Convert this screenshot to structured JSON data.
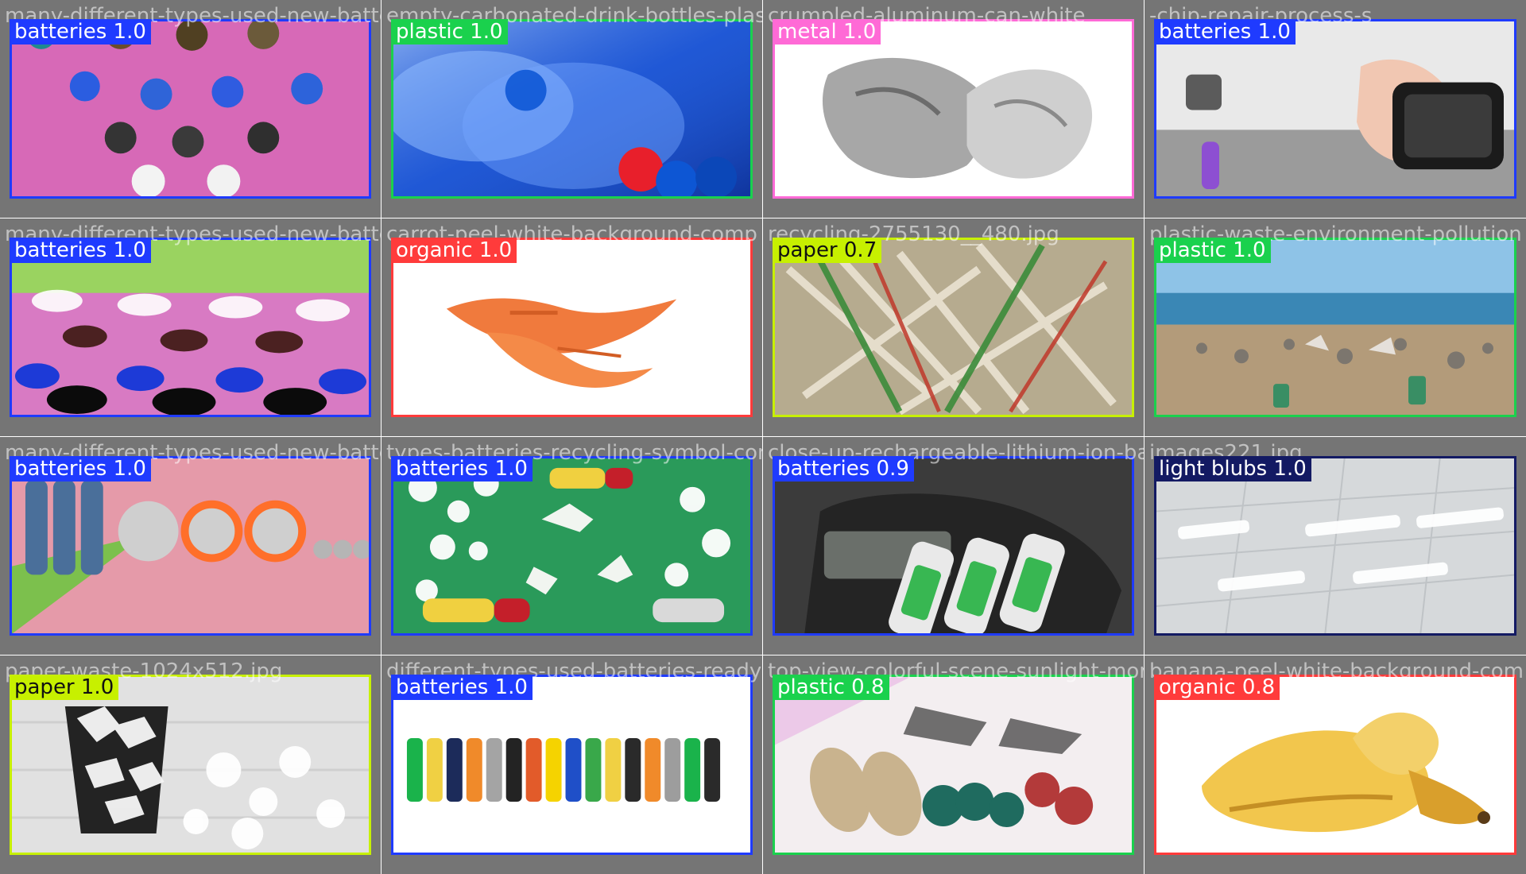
{
  "colors": {
    "batteries": "#1f3bff",
    "plastic": "#1ad14d",
    "metal": "#ff6ad6",
    "paper": "#c7f000",
    "organic": "#ff3b3b",
    "light blubs": "#131a63"
  },
  "tiles": [
    {
      "filename": "many-different-types-used-new-batte",
      "label": "batteries 1.0",
      "class": "batteries",
      "scene": "pink-tiles"
    },
    {
      "filename": "empty-carbonated-drink-bottles-plast",
      "label": "plastic 1.0",
      "class": "plastic",
      "scene": "blue-bottles"
    },
    {
      "filename": "crumpled-aluminum-can-white",
      "label": "metal 1.0",
      "class": "metal",
      "scene": "crumpled-can"
    },
    {
      "filename": "-chip-repair-process-s",
      "label": "batteries 1.0",
      "class": "batteries",
      "scene": "phone-repair"
    },
    {
      "filename": "many-different-types-used-new-batte",
      "label": "batteries 1.0",
      "class": "batteries",
      "scene": "caps"
    },
    {
      "filename": "carrot-peel-white-background-comp",
      "label": "organic 1.0",
      "class": "organic",
      "scene": "peel"
    },
    {
      "filename": "recycling-2755130__480.jpg",
      "label": "paper 0.7",
      "class": "paper",
      "scene": "shredded"
    },
    {
      "filename": "plastic-waste-environment-pollution",
      "label": "plastic 1.0",
      "class": "plastic",
      "scene": "beach"
    },
    {
      "filename": "many-different-types-used-new-batte",
      "label": "batteries 1.0",
      "class": "batteries",
      "scene": "cells"
    },
    {
      "filename": "types-batteries-recycling-symbol-conce",
      "label": "batteries 1.0",
      "class": "batteries",
      "scene": "recycle-green"
    },
    {
      "filename": "close-up-rechargeable-lithium-ion-batte",
      "label": "batteries 0.9",
      "class": "batteries",
      "scene": "charger"
    },
    {
      "filename": "images221.jpg",
      "label": "light blubs 1.0",
      "class": "light blubs",
      "scene": "ceiling"
    },
    {
      "filename": "paper-waste-1024x512.jpg",
      "label": "paper 1.0",
      "class": "paper",
      "scene": "bin"
    },
    {
      "filename": "different-types-used-batteries-ready-",
      "label": "batteries 1.0",
      "class": "batteries",
      "scene": "aa-row"
    },
    {
      "filename": "top-view-colorful-scene-sunlight-mor",
      "label": "plastic 0.8",
      "class": "plastic",
      "scene": "flatlay"
    },
    {
      "filename": "banana-peel-white-background-com",
      "label": "organic 0.8",
      "class": "organic",
      "scene": "banana"
    }
  ]
}
